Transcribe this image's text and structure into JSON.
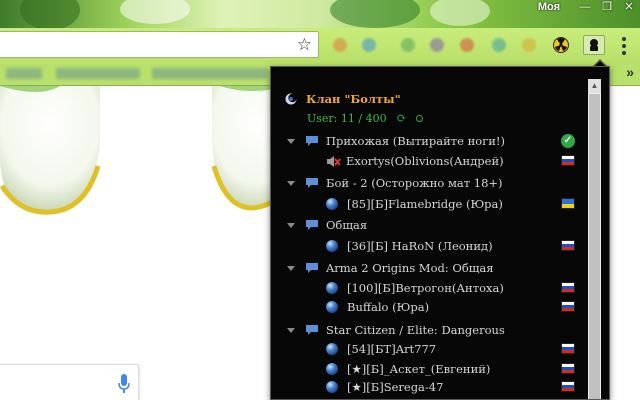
{
  "window": {
    "user_label": "Моя",
    "minimize": "—",
    "restore": "❐",
    "close": "✕"
  },
  "bookmarks": {
    "more": "»"
  },
  "popup": {
    "clan_title": "Клан \"Болты\"",
    "users_online": "User: 11 / 400",
    "channels": [
      {
        "name": "Прихожая (Вытирайте ноги!)",
        "status": "check",
        "users": [
          {
            "name": "Exortys(Oblivions(Андрей)",
            "muted": true,
            "flag": "ru"
          }
        ]
      },
      {
        "name": "Бой - 2 (Осторожно мат 18+)",
        "users": [
          {
            "name": "[85][Б]Flamebridge (Юра)",
            "flag": "ua"
          }
        ]
      },
      {
        "name": "Общая",
        "users": [
          {
            "name": "[36][Б] HaRoN (Леонид)",
            "flag": "ru"
          }
        ]
      },
      {
        "name": "Arma 2 Origins Mod: Общая",
        "users": [
          {
            "name": "[100][Б]Ветрогон(Антоха)",
            "flag": "ru"
          },
          {
            "name": "Buffalo (Юра)",
            "flag": "ru"
          }
        ]
      },
      {
        "name": "Star Citizen / Elite: Dangerous",
        "users": [
          {
            "name": "[54][БТ]Art777",
            "flag": "ru"
          },
          {
            "name": "[★][Б]_Аскет_(Евгений)",
            "flag": "ru"
          },
          {
            "name": "[★][Б]Serega-47",
            "flag": "ru"
          }
        ]
      }
    ]
  },
  "colors": {
    "clan_title": "#f0a733",
    "users_online": "#45b83f",
    "popup_bg": "#070707"
  }
}
